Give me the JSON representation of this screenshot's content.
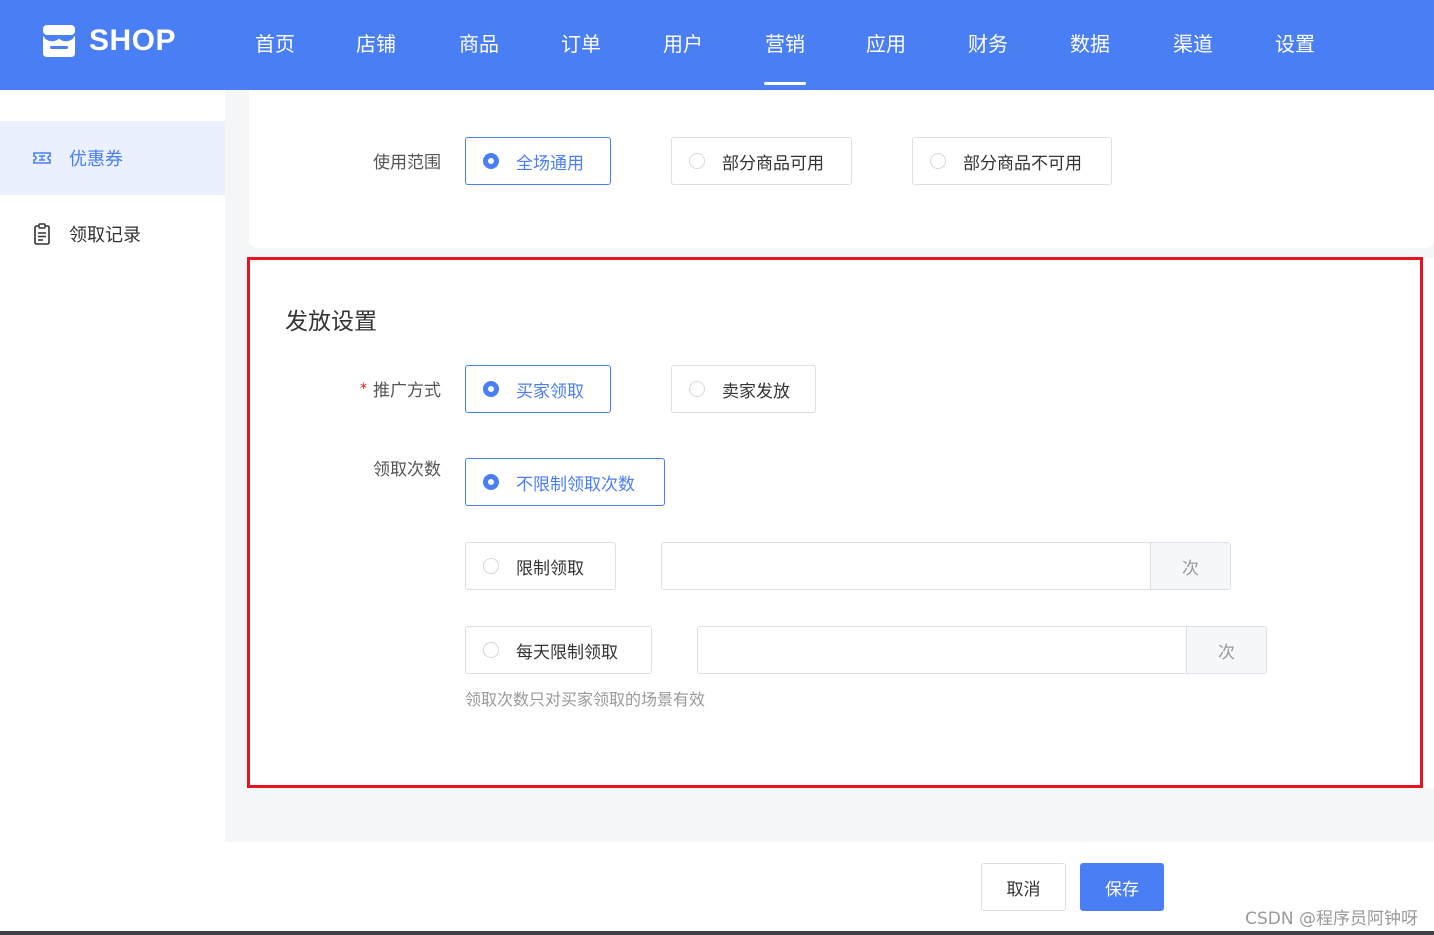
{
  "brand": {
    "name": "SHOP",
    "logo_icon": "shop-icon"
  },
  "nav": {
    "items": [
      {
        "label": "首页"
      },
      {
        "label": "店铺"
      },
      {
        "label": "商品"
      },
      {
        "label": "订单"
      },
      {
        "label": "用户"
      },
      {
        "label": "营销"
      },
      {
        "label": "应用"
      },
      {
        "label": "财务"
      },
      {
        "label": "数据"
      },
      {
        "label": "渠道"
      },
      {
        "label": "设置"
      }
    ],
    "active": "营销"
  },
  "sidebar": {
    "items": [
      {
        "label": "优惠券",
        "icon": "ticket-icon",
        "active": true
      },
      {
        "label": "领取记录",
        "icon": "clipboard-icon",
        "active": false
      }
    ]
  },
  "scope": {
    "label": "使用范围",
    "options": [
      {
        "label": "全场通用",
        "checked": true
      },
      {
        "label": "部分商品可用",
        "checked": false
      },
      {
        "label": "部分商品不可用",
        "checked": false
      }
    ]
  },
  "issue": {
    "title": "发放设置",
    "promo": {
      "label": "推广方式",
      "required_mark": "*",
      "options": [
        {
          "label": "买家领取",
          "checked": true
        },
        {
          "label": "卖家发放",
          "checked": false
        }
      ]
    },
    "times": {
      "label": "领取次数",
      "unlimited": {
        "label": "不限制领取次数",
        "checked": true
      },
      "limited": {
        "label": "限制领取",
        "checked": false,
        "value": "",
        "suffix": "次"
      },
      "daily": {
        "label": "每天限制领取",
        "checked": false,
        "value": "",
        "suffix": "次"
      },
      "hint": "领取次数只对买家领取的场景有效"
    }
  },
  "actions": {
    "cancel": "取消",
    "save": "保存"
  },
  "watermark": "CSDN @程序员阿钟呀",
  "colors": {
    "primary": "#4a7ef5",
    "highlight_border": "#e5141e"
  }
}
